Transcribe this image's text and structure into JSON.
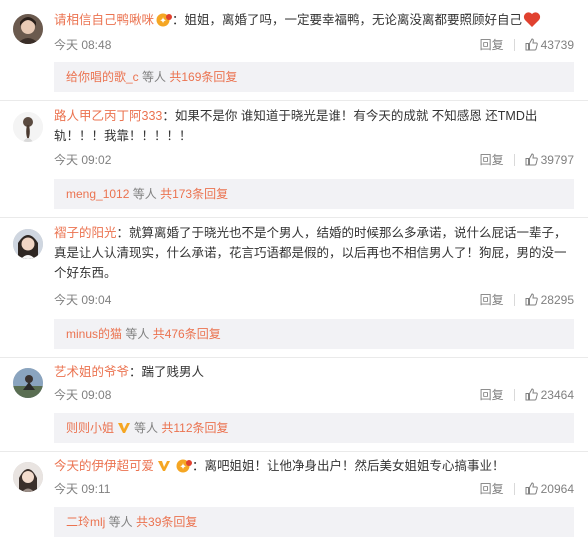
{
  "comments": [
    {
      "user": "请相信自己鸭啾咪",
      "text": "：姐姐，离婚了吗，一定要幸福鸭，无论离没离都要照顾好自己",
      "time": "今天 08:48",
      "reply": "回复",
      "likes": "43739",
      "reply_user": "给你唱的歌_c",
      "reply_mid": " 等人 ",
      "reply_count": "共169条回复"
    },
    {
      "user": "路人甲乙丙丁阿333",
      "text": "：如果不是你 谁知道于晓光是谁！有今天的成就 不知感恩 还TMD出轨！！！我靠！！！！！",
      "time": "今天 09:02",
      "reply": "回复",
      "likes": "39797",
      "reply_user": "meng_1012",
      "reply_mid": " 等人 ",
      "reply_count": "共173条回复"
    },
    {
      "user": "褶子的阳光",
      "text": "：就算离婚了于晓光也不是个男人，结婚的时候那么多承诺，说什么屁话一辈子，真是让人认清现实，什么承诺，花言巧语都是假的，以后再也不相信男人了！狗屁，男的没一个好东西。",
      "time": "今天 09:04",
      "reply": "回复",
      "likes": "28295",
      "reply_user": "minus的猫",
      "reply_mid": " 等人 ",
      "reply_count": "共476条回复"
    },
    {
      "user": "艺术姐的爷爷",
      "text": "：踹了贱男人",
      "time": "今天 09:08",
      "reply": "回复",
      "likes": "23464",
      "reply_user": "则则小姐",
      "reply_mid": "等人 ",
      "reply_count": "共112条回复"
    },
    {
      "user": "今天的伊伊超可爱",
      "text": "：离吧姐姐！让他净身出户！然后美女姐姐专心搞事业！",
      "time": "今天 09:11",
      "reply": "回复",
      "likes": "20964",
      "reply_user": "二玲mlj",
      "reply_mid": " 等人 ",
      "reply_count": "共39条回复"
    }
  ],
  "colors": {
    "accent": "#eb7350",
    "meta": "#808080",
    "reply_bg": "#f2f2f5",
    "vip": "#f5a623"
  },
  "icons": {
    "like": "thumbs-up-icon",
    "heart": "heart-icon",
    "vip": "vip-badge-icon",
    "v": "v-badge-icon"
  }
}
